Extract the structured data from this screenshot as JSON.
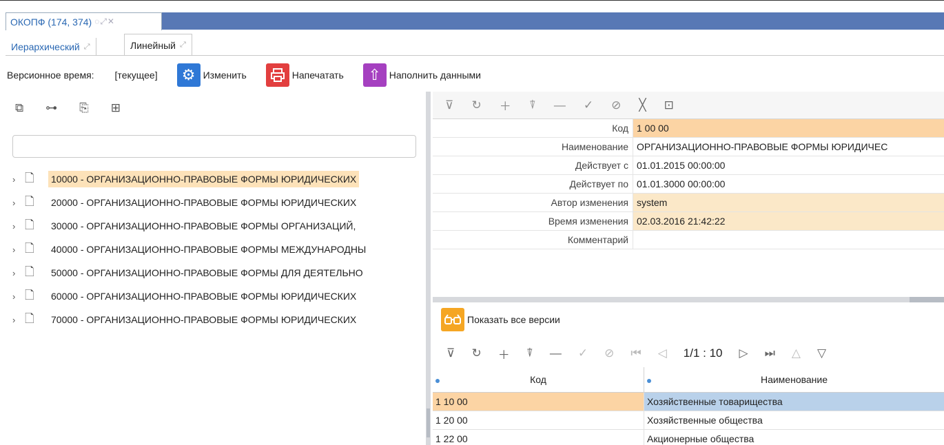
{
  "window_tab": {
    "title": "ОКОПФ (174, 374)",
    "icons": "◌⤢✕"
  },
  "subtabs": [
    {
      "label": "Иерархический",
      "expand": "⤢"
    },
    {
      "label": "Линейный",
      "expand": "⤢"
    }
  ],
  "version_bar": {
    "label": "Версионное время:",
    "value": "[текущее]",
    "change_label": "Изменить",
    "print_label": "Напечатать",
    "fill_label": "Наполнить данными"
  },
  "tree": {
    "search_value": "",
    "items": [
      {
        "label": "10000 - ОРГАНИЗАЦИОННО-ПРАВОВЫЕ ФОРМЫ ЮРИДИЧЕСКИХ",
        "selected": true
      },
      {
        "label": "20000 - ОРГАНИЗАЦИОННО-ПРАВОВЫЕ ФОРМЫ ЮРИДИЧЕСКИХ",
        "selected": false
      },
      {
        "label": "30000 - ОРГАНИЗАЦИОННО-ПРАВОВЫЕ ФОРМЫ ОРГАНИЗАЦИЙ,",
        "selected": false
      },
      {
        "label": "40000 - ОРГАНИЗАЦИОННО-ПРАВОВЫЕ ФОРМЫ МЕЖДУНАРОДНЫ",
        "selected": false
      },
      {
        "label": "50000 - ОРГАНИЗАЦИОННО-ПРАВОВЫЕ ФОРМЫ ДЛЯ ДЕЯТЕЛЬНО",
        "selected": false
      },
      {
        "label": "60000 - ОРГАНИЗАЦИОННО-ПРАВОВЫЕ ФОРМЫ ЮРИДИЧЕСКИХ",
        "selected": false
      },
      {
        "label": "70000 - ОРГАНИЗАЦИОННО-ПРАВОВЫЕ ФОРМЫ ЮРИДИЧЕСКИХ",
        "selected": false
      }
    ]
  },
  "detail": {
    "rows": [
      {
        "key": "Код",
        "value": "1 00 00"
      },
      {
        "key": "Наименование",
        "value": "ОРГАНИЗАЦИОННО-ПРАВОВЫЕ ФОРМЫ ЮРИДИЧЕС"
      },
      {
        "key": "Действует с",
        "value": "01.01.2015 00:00:00"
      },
      {
        "key": "Действует по",
        "value": "01.01.3000 00:00:00"
      },
      {
        "key": "Автор изменения",
        "value": "system"
      },
      {
        "key": "Время изменения",
        "value": "02.03.2016 21:42:22"
      },
      {
        "key": "Комментарий",
        "value": ""
      }
    ]
  },
  "versions": {
    "show_all_label": "Показать все версии",
    "pager": "1/1 : 10",
    "columns": [
      "Код",
      "Наименование"
    ],
    "rows": [
      [
        "1 10 00",
        "Хозяйственные товарищества"
      ],
      [
        "1 20 00",
        "Хозяйственные общества"
      ],
      [
        "1 22 00",
        "Акционерные общества"
      ]
    ]
  },
  "colors": {
    "title_strip": "#5878b5",
    "accent_text": "#2a68b3",
    "selected_row": "#fde2b9",
    "highlight_orange": "#fcd4a4",
    "highlight_beige": "#fbe8c8",
    "selected_cell_blue": "#b9d1ea"
  }
}
